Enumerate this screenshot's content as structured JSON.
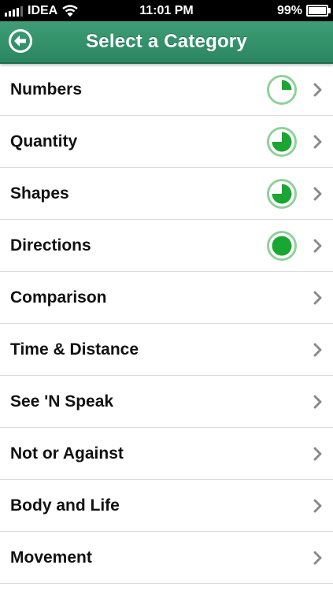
{
  "status_bar": {
    "carrier": "IDEA",
    "time": "11:01 PM",
    "battery": "99%",
    "icons": [
      "signal-icon",
      "wifi-icon",
      "battery-icon"
    ]
  },
  "nav": {
    "title": "Select a Category",
    "back_icon": "back-arrow-icon"
  },
  "colors": {
    "nav_green": "#2f8f67",
    "progress_green": "#1aa632",
    "progress_ring": "#8fd19a",
    "chevron": "#8a8a8a"
  },
  "categories": [
    {
      "label": "Numbers",
      "progress": 0.25
    },
    {
      "label": "Quantity",
      "progress": 0.75
    },
    {
      "label": "Shapes",
      "progress": 0.75
    },
    {
      "label": "Directions",
      "progress": 1.0
    },
    {
      "label": "Comparison",
      "progress": null
    },
    {
      "label": "Time & Distance",
      "progress": null
    },
    {
      "label": "See 'N Speak",
      "progress": null
    },
    {
      "label": "Not or Against",
      "progress": null
    },
    {
      "label": "Body and Life",
      "progress": null
    },
    {
      "label": "Movement",
      "progress": null
    }
  ]
}
